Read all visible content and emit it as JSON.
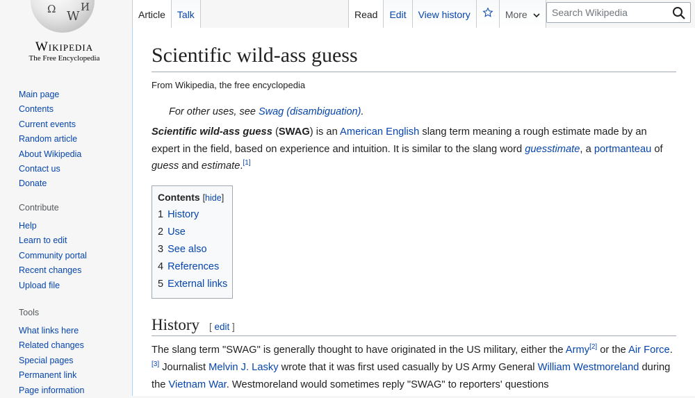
{
  "logo": {
    "wordmark": "Wikipedia",
    "tagline": "The Free Encyclopedia",
    "puzzle_glyphs": [
      "Ω",
      "W",
      "И"
    ]
  },
  "sidebar": {
    "navigation": [
      "Main page",
      "Contents",
      "Current events",
      "Random article",
      "About Wikipedia",
      "Contact us",
      "Donate"
    ],
    "contribute": {
      "heading": "Contribute",
      "items": [
        "Help",
        "Learn to edit",
        "Community portal",
        "Recent changes",
        "Upload file"
      ]
    },
    "tools": {
      "heading": "Tools",
      "items": [
        "What links here",
        "Related changes",
        "Special pages",
        "Permanent link",
        "Page information"
      ]
    }
  },
  "tabs": {
    "article": "Article",
    "talk": "Talk",
    "read": "Read",
    "edit": "Edit",
    "history": "View history",
    "more": "More",
    "watch_icon": "star-icon"
  },
  "search": {
    "placeholder": "Search Wikipedia",
    "icon": "search-icon"
  },
  "article": {
    "title": "Scientific wild-ass guess",
    "site_sub": "From Wikipedia, the free encyclopedia",
    "hatnote": {
      "prefix": "For other uses, see ",
      "link": "Swag (disambiguation)",
      "suffix": "."
    },
    "lead": {
      "bold_italic": "Scientific wild-ass guess",
      "t1": " (",
      "bold": "SWAG",
      "t2": ") is an ",
      "link1": "American English",
      "t3": " slang term meaning a rough estimate made by an expert in the field, based on experience and intuition. It is similar to the slang word ",
      "link2": "guesstimate",
      "t4": ", a ",
      "link3": "portmanteau",
      "t5": " of ",
      "i1": "guess",
      "t6": " and ",
      "i2": "estimate",
      "t7": ".",
      "ref": "[1]"
    },
    "toc": {
      "title": "Contents",
      "hide_open": "[",
      "hide": "hide",
      "hide_close": "]",
      "items": [
        {
          "num": "1",
          "label": "History"
        },
        {
          "num": "2",
          "label": "Use"
        },
        {
          "num": "3",
          "label": "See also"
        },
        {
          "num": "4",
          "label": "References"
        },
        {
          "num": "5",
          "label": "External links"
        }
      ]
    },
    "history": {
      "heading": "History",
      "edit_open": "[ ",
      "edit": "edit",
      "edit_close": " ]",
      "t1": "The slang term \"SWAG\" is generally thought to have originated in the US military, either the ",
      "link1": "Army",
      "ref1": "[2]",
      "t2": " or the ",
      "link2": "Air Force",
      "t3": ".",
      "ref2": "[3]",
      "t4": " Journalist ",
      "link3": "Melvin J. Lasky",
      "t5": " wrote that it was first used casually by US Army General ",
      "link4": "William Westmoreland",
      "t6": " during the ",
      "link5": "Vietnam War",
      "t7": ". Westmoreland would sometimes reply \"SWAG\" to reporters' questions"
    }
  },
  "colors": {
    "link": "#0645ad",
    "text": "#202122",
    "sidebar_bg": "#f6f6f6",
    "border": "#a2a9b1"
  }
}
